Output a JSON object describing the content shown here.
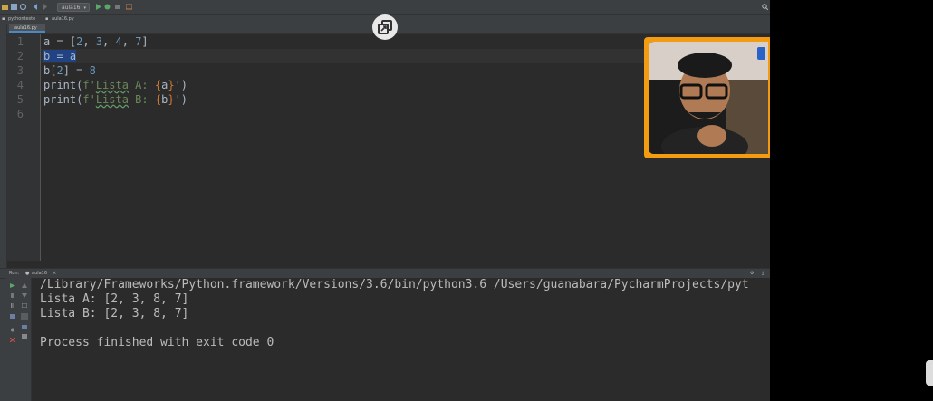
{
  "toolbar": {
    "run_config": "aula16"
  },
  "navbar": {
    "project": "pythonteste",
    "file": "aula16.py"
  },
  "editor": {
    "tab_label": "aula16.py",
    "line_numbers": [
      "1",
      "2",
      "3",
      "4",
      "5",
      "6"
    ],
    "lines": [
      {
        "p0": "a = [",
        "n1": "2",
        "c1": ", ",
        "n2": "3",
        "c2": ", ",
        "n3": "4",
        "c3": ", ",
        "n4": "7",
        "p1": "]"
      },
      {
        "sel": "b = a"
      },
      {
        "p0": "b[",
        "n1": "2",
        "p1": "] = ",
        "n2": "8"
      },
      {
        "p0": "print(",
        "s0": "f'",
        "s1": "Lista",
        "s2": " A: ",
        "b0": "{",
        "v": "a",
        "b1": "}",
        "s3": "'",
        "p1": ")"
      },
      {
        "p0": "print(",
        "s0": "f'",
        "s1": "Lista",
        "s2": " B: ",
        "b0": "{",
        "v": "b",
        "b1": "}",
        "s3": "'",
        "p1": ")"
      }
    ]
  },
  "run": {
    "header_label": "Run:",
    "config": "aula16",
    "output": [
      "/Library/Frameworks/Python.framework/Versions/3.6/bin/python3.6 /Users/guanabara/PycharmProjects/pyt",
      "Lista A: [2, 3, 8, 7]",
      "Lista B: [2, 3, 8, 7]",
      "",
      "Process finished with exit code 0"
    ]
  },
  "colors": {
    "editor_bg": "#2b2b2b",
    "panel_bg": "#3c3f41",
    "selection": "#214283",
    "number": "#6897bb",
    "string": "#6a8759",
    "webcam_border": "#f39c12"
  }
}
